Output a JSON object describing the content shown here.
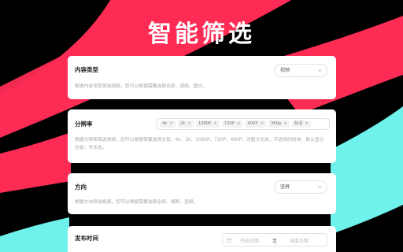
{
  "header": {
    "title": "智能筛选"
  },
  "colors": {
    "background": "#000000",
    "red": "#fe2c55",
    "cyan": "#6ff2ec",
    "card": "#ffffff"
  },
  "cards": [
    {
      "title": "内容类型",
      "description": "根据内容类型筛选视频，您可以根据需要选择全部、视频、图文。",
      "select_value": "视频"
    },
    {
      "title": "分辨率",
      "description": "根据分辨率筛选视频，您可以根据需要选择全部、4k、2k、1080P、720P、480P，对图文无效，不选择的时候，默认显示全部，可多选。",
      "tags": [
        "4k",
        "2k",
        "1080P",
        "720P",
        "400P",
        "360p",
        "标清"
      ]
    },
    {
      "title": "方向",
      "description": "根据方向筛选视频，您可以根据需要选择全部、横屏、竖屏。",
      "select_value": "竖屏"
    },
    {
      "title": "发布时间",
      "date_start_placeholder": "开始日期",
      "date_separator": "至",
      "date_end_placeholder": "结束日期"
    }
  ],
  "icons": {
    "chevron": "chevron-down-icon",
    "tag_close": "close-icon",
    "calendar": "calendar-icon"
  }
}
